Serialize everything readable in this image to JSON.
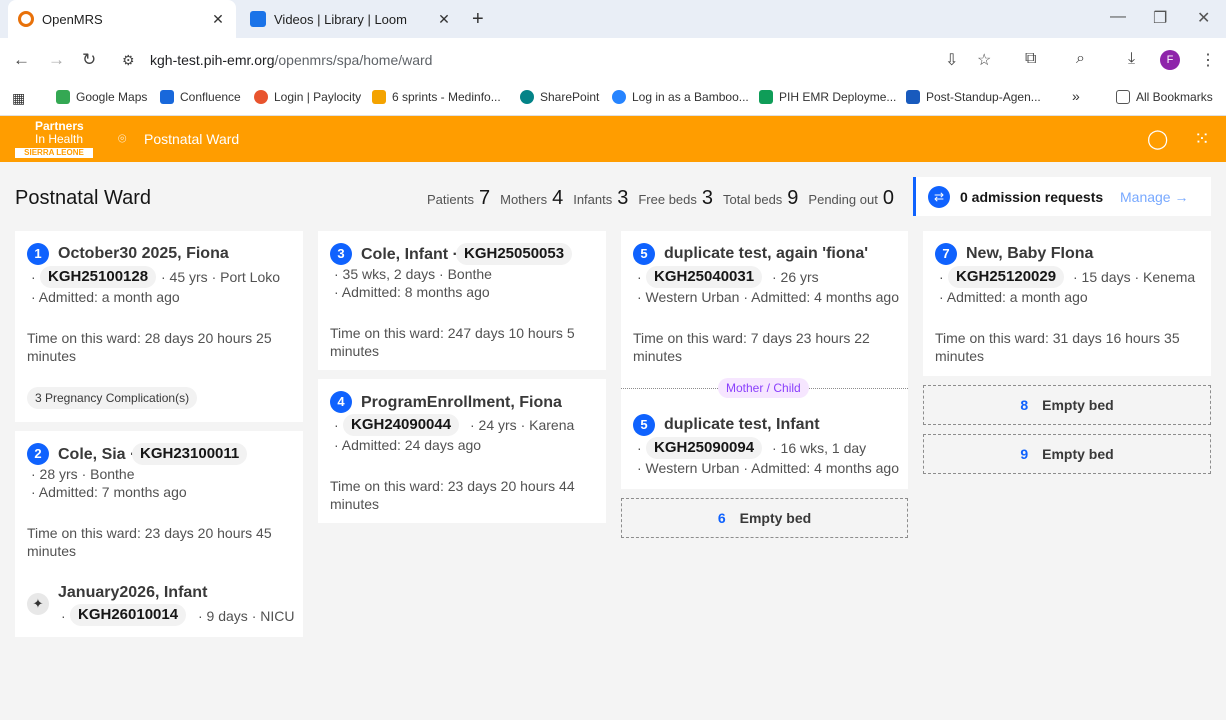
{
  "browser": {
    "tabs": [
      {
        "title": "OpenMRS",
        "active": true
      },
      {
        "title": "Videos | Library | Loom",
        "active": false
      }
    ],
    "url_host": "kgh-test.pih-emr.org",
    "url_path": "/openmrs/spa/home/ward",
    "profile_initial": "F",
    "bookmarks": [
      "Google Maps",
      "Confluence",
      "Login | Paylocity",
      "6 sprints - Medinfo...",
      "SharePoint",
      "Log in as a Bamboo...",
      "PIH EMR Deployme...",
      "Post-Standup-Agen..."
    ],
    "all_bookmarks": "All Bookmarks"
  },
  "app": {
    "logo_line1": "Partners",
    "logo_line2": "In Health",
    "logo_sub": "SIERRA LEONE",
    "location": "Postnatal Ward",
    "brand_color": "#ff9d00"
  },
  "ward": {
    "title": "Postnatal Ward",
    "stats": [
      {
        "label": "Patients",
        "value": "7"
      },
      {
        "label": "Mothers",
        "value": "4"
      },
      {
        "label": "Infants",
        "value": "3"
      },
      {
        "label": "Free beds",
        "value": "3"
      },
      {
        "label": "Total beds",
        "value": "9"
      },
      {
        "label": "Pending out",
        "value": "0"
      }
    ],
    "admission_requests": "0 admission requests",
    "manage": "Manage"
  },
  "beds": {
    "b1": {
      "num": "1",
      "name": "October30 2025, Fiona",
      "id": "KGH25100128",
      "meta1": "· 45 yrs · Port Loko",
      "meta2": "· Admitted: a month ago",
      "tow": "Time on this ward: 28 days 20 hours 25 minutes",
      "tag": "3 Pregnancy Complication(s)"
    },
    "b2": {
      "num": "2",
      "name": "Cole, Sia ·",
      "id": "KGH23100011",
      "meta1": "· 28 yrs · Bonthe",
      "meta2": "· Admitted: 7 months ago",
      "tow": "Time on this ward: 23 days 20 hours 45 minutes",
      "infant_name": "January2026, Infant",
      "infant_id": "KGH26010014",
      "infant_meta": "· 9 days · NICU"
    },
    "b3": {
      "num": "3",
      "name": "Cole, Infant ·",
      "id": "KGH25050053",
      "meta1": "· 35 wks, 2 days · Bonthe",
      "meta2": "· Admitted: 8 months ago",
      "tow": "Time on this ward: 247 days 10 hours 5 minutes"
    },
    "b4": {
      "num": "4",
      "name": "ProgramEnrollment, Fiona",
      "id": "KGH24090044",
      "meta1": "· 24 yrs · Karena",
      "meta2": "· Admitted: 24 days ago",
      "tow": "Time on this ward: 23 days 20 hours 44 minutes"
    },
    "b5a": {
      "num": "5",
      "name": "duplicate test, again 'fiona'",
      "id": "KGH25040031",
      "meta1": "· 26 yrs",
      "meta2": "· Western Urban · Admitted: 4 months ago",
      "tow": "Time on this ward: 7 days 23 hours 22 minutes"
    },
    "mother_child": "Mother / Child",
    "b5b": {
      "num": "5",
      "name": "duplicate test, Infant",
      "id": "KGH25090094",
      "meta1": "· 16 wks, 1 day",
      "meta2": "· Western Urban · Admitted: 4 months ago"
    },
    "b6": {
      "num": "6",
      "label": "Empty bed"
    },
    "b7": {
      "num": "7",
      "name": "New, Baby FIona",
      "id": "KGH25120029",
      "meta1": "· 15 days · Kenema",
      "meta2": "· Admitted: a month ago",
      "tow": "Time on this ward: 31 days 16 hours 35 minutes"
    },
    "b8": {
      "num": "8",
      "label": "Empty bed"
    },
    "b9": {
      "num": "9",
      "label": "Empty bed"
    }
  }
}
